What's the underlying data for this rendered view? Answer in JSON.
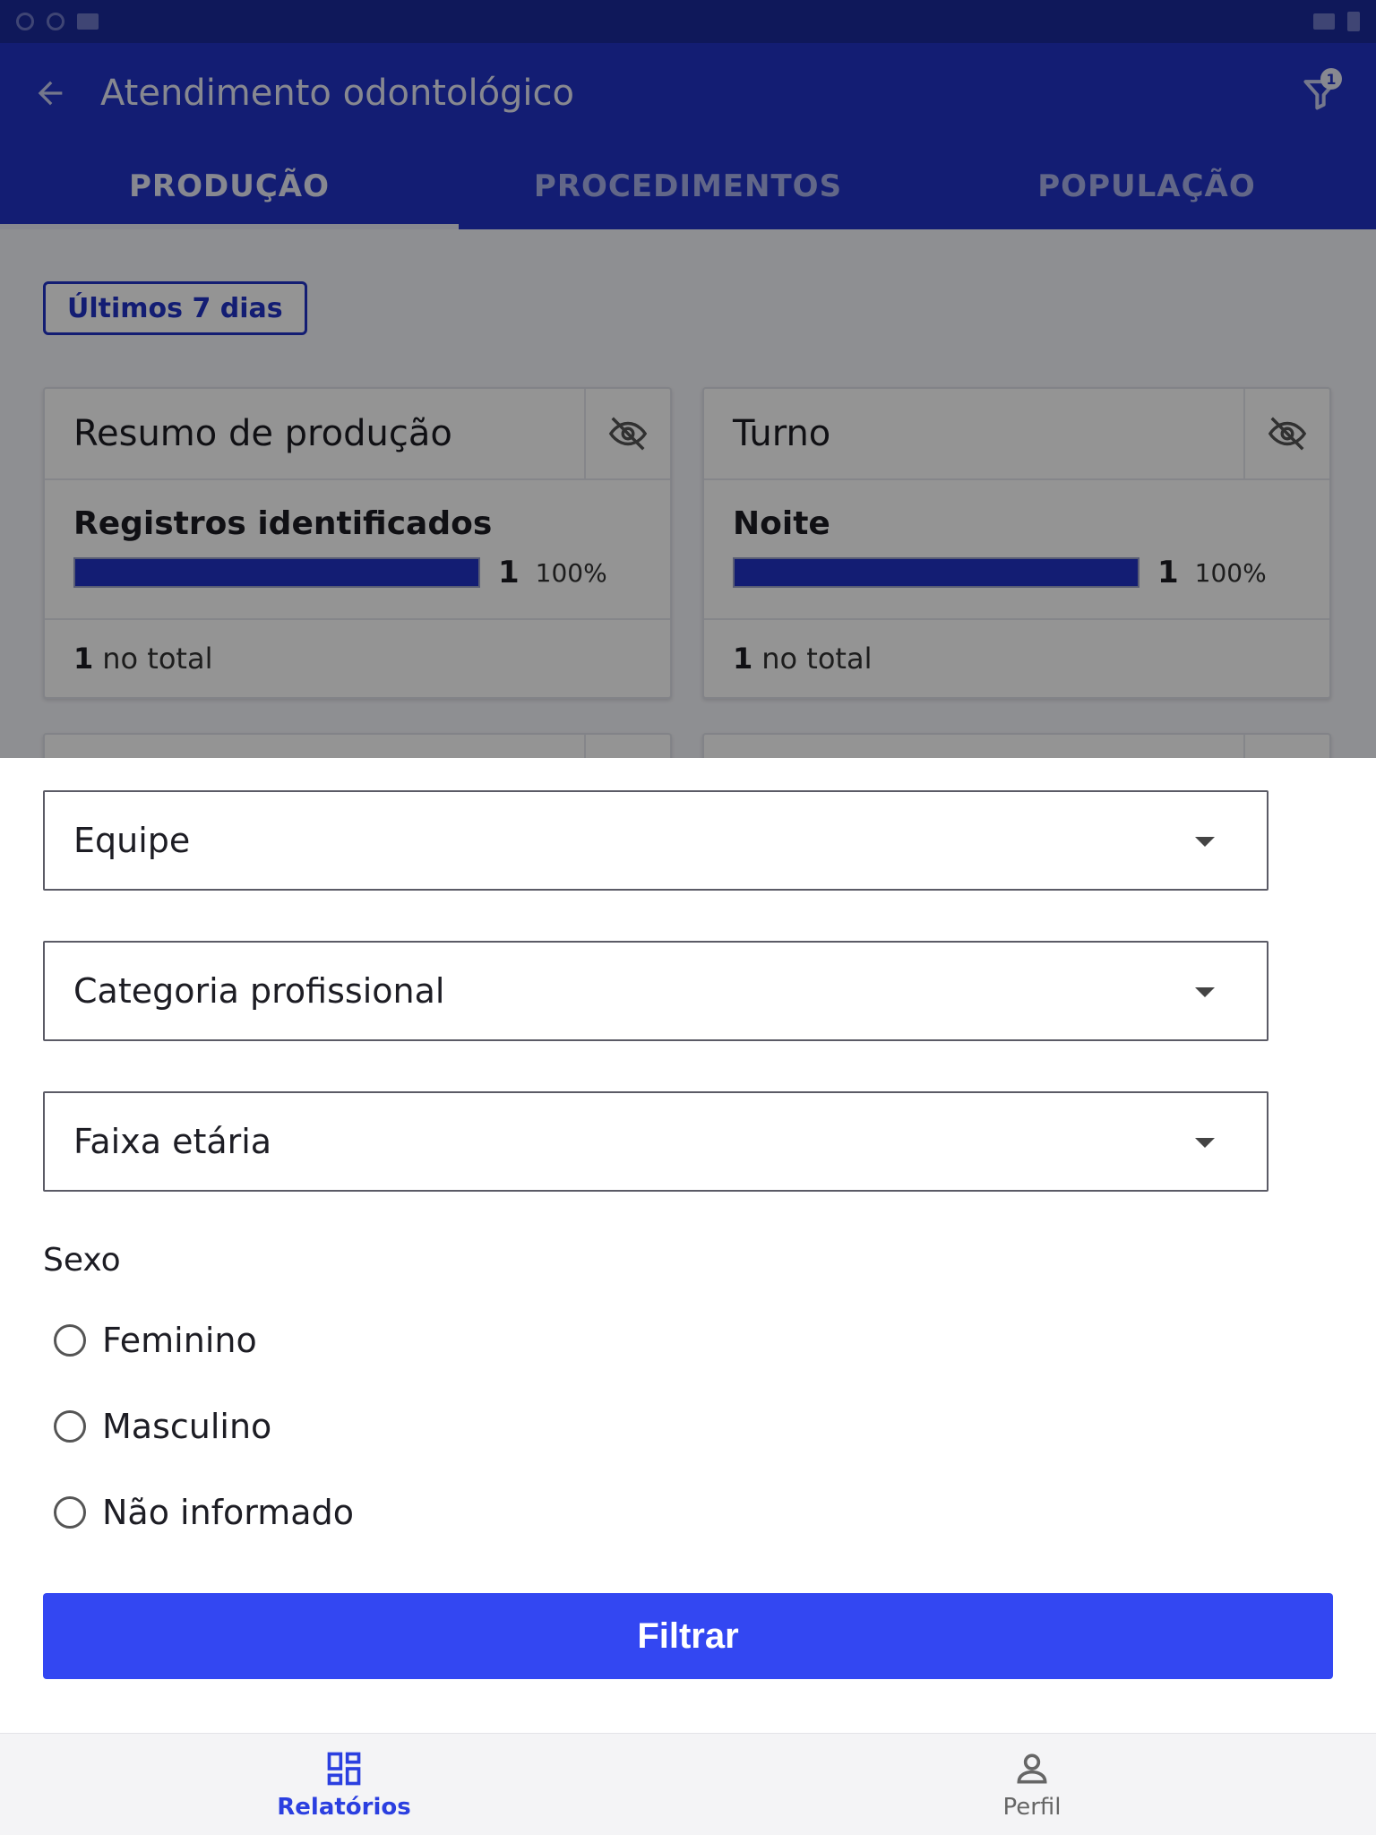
{
  "app": {
    "title": "Atendimento odontológico",
    "filter_badge": "1"
  },
  "tabs": [
    {
      "label": "PRODUÇÃO",
      "active": true
    },
    {
      "label": "PROCEDIMENTOS",
      "active": false
    },
    {
      "label": "POPULAÇÃO",
      "active": false
    }
  ],
  "period_chip": "Últimos 7 dias",
  "cards": [
    {
      "title": "Resumo de produção",
      "row_label": "Registros identificados",
      "count": "1",
      "percent": "100%",
      "fill_fraction": 1.0,
      "total_count": "1",
      "total_label": "no total"
    },
    {
      "title": "Turno",
      "row_label": "Noite",
      "count": "1",
      "percent": "100%",
      "fill_fraction": 1.0,
      "total_count": "1",
      "total_label": "no total"
    }
  ],
  "filters": {
    "selects": [
      {
        "label": "Equipe"
      },
      {
        "label": "Categoria profissional"
      },
      {
        "label": "Faixa etária"
      }
    ],
    "sexo_label": "Sexo",
    "sexo_options": [
      "Feminino",
      "Masculino",
      "Não informado"
    ],
    "submit_label": "Filtrar"
  },
  "bottom_nav": [
    {
      "label": "Relatórios",
      "active": true
    },
    {
      "label": "Perfil",
      "active": false
    }
  ],
  "colors": {
    "primary": "#2233c6",
    "button": "#3347f2",
    "nav_active": "#2b3fe0"
  },
  "icons": [
    "back-arrow-icon",
    "filter-icon",
    "eye-off-icon",
    "dashboard-icon",
    "person-icon"
  ]
}
